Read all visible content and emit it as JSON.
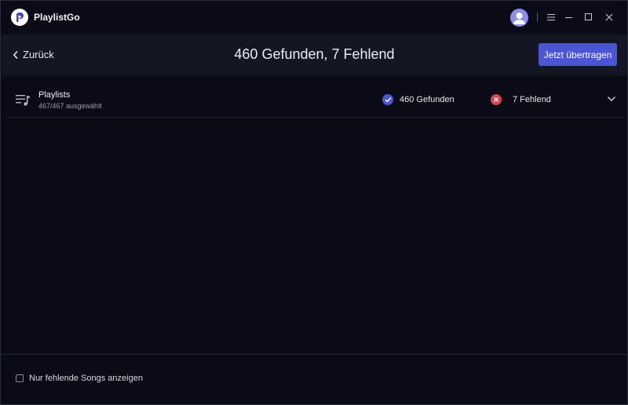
{
  "app": {
    "title": "PlaylistGo"
  },
  "icons": {
    "logo": "playlistgo-logo-icon",
    "avatar": "user-icon",
    "menu": "menu-icon",
    "minimize": "minimize-icon",
    "maximize": "maximize-icon",
    "close": "close-icon",
    "back": "chevron-left-icon",
    "playlist": "playlist-icon",
    "found": "check-circle-icon",
    "missing": "x-circle-icon",
    "expand": "chevron-down-icon"
  },
  "header": {
    "back_label": "Zurück",
    "title": "460 Gefunden, 7 Fehlend",
    "transfer_label": "Jetzt übertragen"
  },
  "playlist_row": {
    "title": "Playlists",
    "subtitle": "467/467 ausgewählt",
    "found_label": "460 Gefunden",
    "missing_label": "7 Fehlend"
  },
  "footer": {
    "show_missing_label": "Nur fehlende Songs anzeigen",
    "show_missing_checked": false
  },
  "colors": {
    "background": "#0b0b17",
    "header": "#151624",
    "accent": "#4a55d3",
    "found": "#4a55d3",
    "missing": "#d9434f",
    "avatar": "#8a8ff0"
  }
}
